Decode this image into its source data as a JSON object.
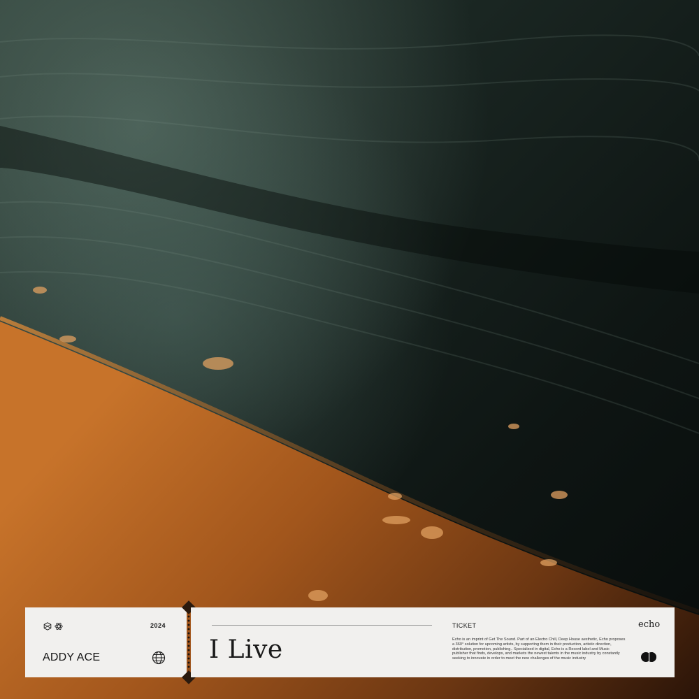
{
  "cover": {
    "year": "2024",
    "artist": "ADDY ACE",
    "title": "I Live",
    "ticket_label": "TICKET",
    "brand": "echo",
    "description": "Echo is an imprint of Get The Sound. Part of an Electro Chill, Deep House aesthetic, Echo proposes a 360° solution for upcoming artists, by supporting them in their production, artistic direction, distribution, promotion, publishing.. Specialized in digital, Echo is a Record label and Music publisher that finds, develops, and markets the newest talents in the music industry by constantly seeking to innovate in order to meet the new challenges of the music industry"
  },
  "icons": {
    "stub_left": "hexagon-icon",
    "stub_right": "atom-icon",
    "globe": "globe-icon",
    "logo": "double-circle-icon"
  },
  "colors": {
    "ticket_bg": "#f1f0ee",
    "text": "#1a1a1a",
    "sand": "#b8641d",
    "water": "#1c2a26"
  }
}
